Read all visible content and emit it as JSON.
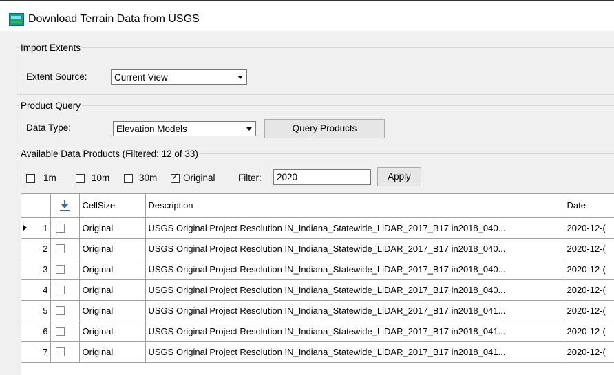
{
  "window": {
    "title": "Download Terrain Data from USGS"
  },
  "import_extents": {
    "legend": "Import Extents",
    "extent_source_label": "Extent Source:",
    "extent_source_value": "Current View"
  },
  "product_query": {
    "legend": "Product Query",
    "data_type_label": "Data Type:",
    "data_type_value": "Elevation Models",
    "query_button": "Query Products"
  },
  "available_products": {
    "legend": "Available Data Products  (Filtered: 12 of 33)",
    "filters": [
      {
        "label": "1m",
        "checked": false
      },
      {
        "label": "10m",
        "checked": false
      },
      {
        "label": "30m",
        "checked": false
      },
      {
        "label": "Original",
        "checked": true
      }
    ],
    "filter_label": "Filter:",
    "filter_value": "2020",
    "apply_button": "Apply"
  },
  "table": {
    "columns": [
      "",
      "download-icon",
      "CellSize",
      "Description",
      "Date"
    ],
    "rows": [
      {
        "num": "1",
        "cellsize": "Original",
        "description": "USGS Original Project Resolution IN_Indiana_Statewide_LiDAR_2017_B17 in2018_040...",
        "date": "2020-12-(",
        "current": true
      },
      {
        "num": "2",
        "cellsize": "Original",
        "description": "USGS Original Project Resolution IN_Indiana_Statewide_LiDAR_2017_B17 in2018_040...",
        "date": "2020-12-("
      },
      {
        "num": "3",
        "cellsize": "Original",
        "description": "USGS Original Project Resolution IN_Indiana_Statewide_LiDAR_2017_B17 in2018_040...",
        "date": "2020-12-("
      },
      {
        "num": "4",
        "cellsize": "Original",
        "description": "USGS Original Project Resolution IN_Indiana_Statewide_LiDAR_2017_B17 in2018_040...",
        "date": "2020-12-("
      },
      {
        "num": "5",
        "cellsize": "Original",
        "description": "USGS Original Project Resolution IN_Indiana_Statewide_LiDAR_2017_B17 in2018_041...",
        "date": "2020-12-("
      },
      {
        "num": "6",
        "cellsize": "Original",
        "description": "USGS Original Project Resolution IN_Indiana_Statewide_LiDAR_2017_B17 in2018_041...",
        "date": "2020-12-("
      },
      {
        "num": "7",
        "cellsize": "Original",
        "description": "USGS Original Project Resolution IN_Indiana_Statewide_LiDAR_2017_B17 in2018_041...",
        "date": "2020-12-("
      }
    ]
  }
}
